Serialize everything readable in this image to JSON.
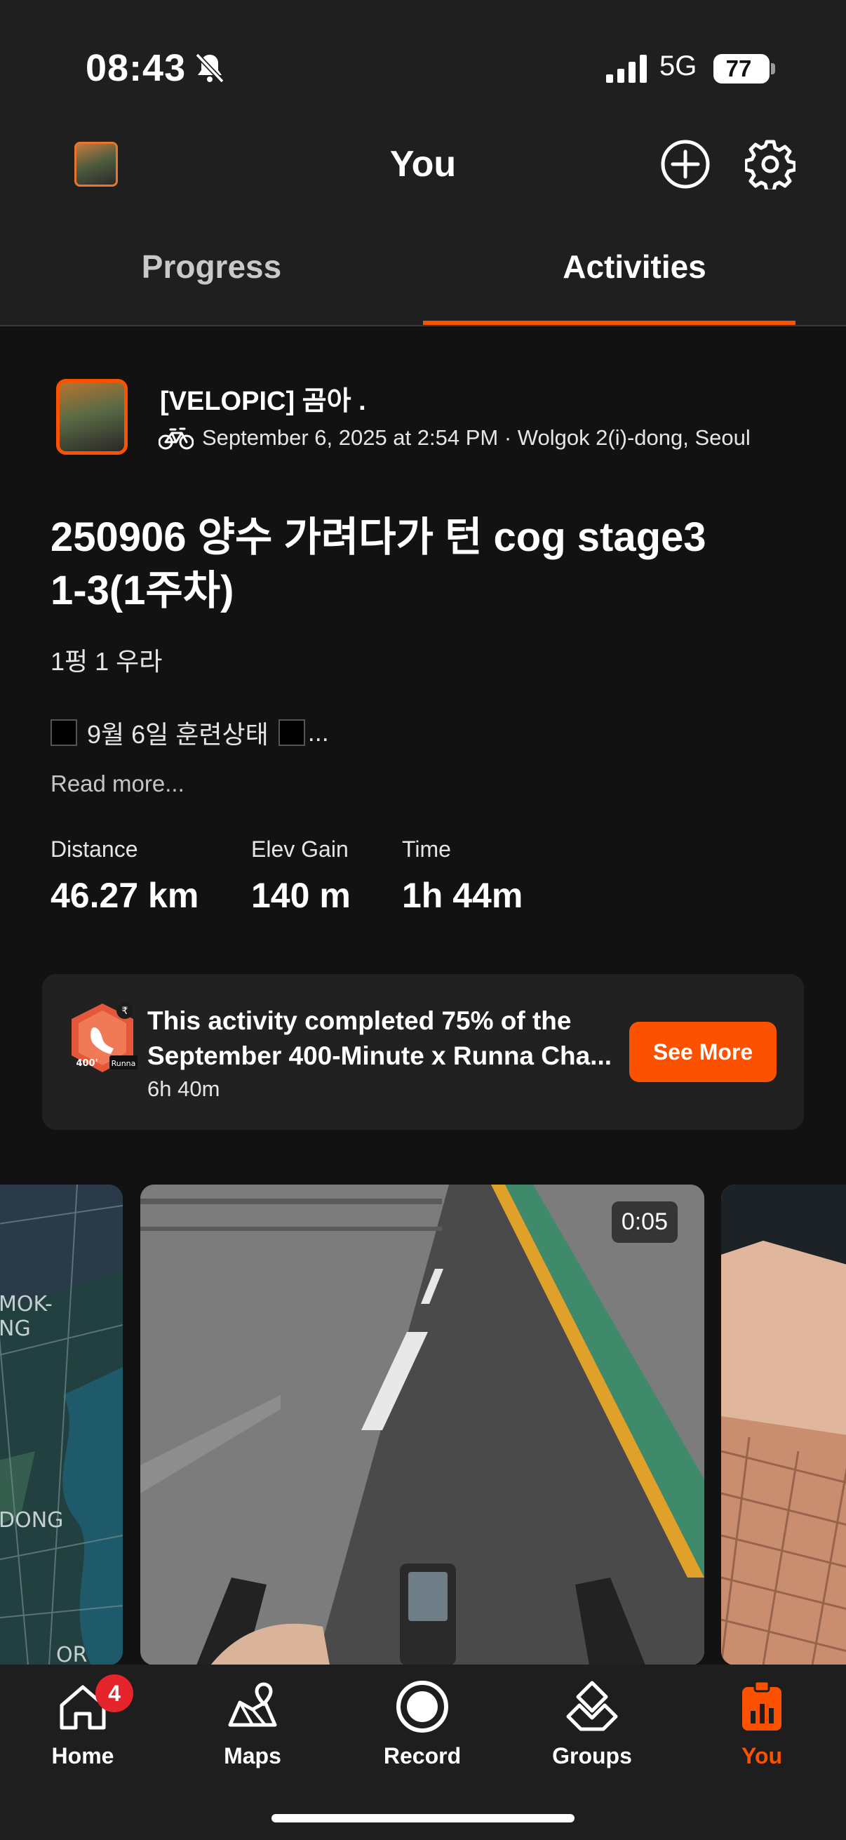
{
  "status_bar": {
    "time": "08:43",
    "network": "5G",
    "battery": "77"
  },
  "header": {
    "title": "You"
  },
  "tabs": [
    {
      "label": "Progress",
      "selected": false
    },
    {
      "label": "Activities",
      "selected": true
    }
  ],
  "activity": {
    "athlete_name": "[VELOPIC] 곰아 .",
    "meta": "September 6, 2025 at 2:54 PM · Wolgok 2(i)-dong, Seoul",
    "title": "250906 양수 가려다가 턴 cog stage3 1-3(1주차)",
    "description_line1": "1펑 1 우라",
    "description_line2": "9월 6일 훈련상태",
    "description_ellipsis": "...",
    "read_more": "Read more...",
    "stats": [
      {
        "label": "Distance",
        "value": "46.27 km"
      },
      {
        "label": "Elev Gain",
        "value": "140 m"
      },
      {
        "label": "Time",
        "value": "1h 44m"
      }
    ]
  },
  "challenge": {
    "line1": "This activity completed 75% of the",
    "line2": "September 400-Minute x Runna Cha...",
    "subtext": "6h 40m",
    "button": "See More",
    "badge_text": "400'",
    "badge_brand": "Runna"
  },
  "media": {
    "map_labels": [
      "MOK-",
      "NG",
      "DONG",
      "OR"
    ],
    "video_duration": "0:05"
  },
  "bottom_nav": [
    {
      "label": "Home",
      "icon": "home-icon",
      "badge": "4"
    },
    {
      "label": "Maps",
      "icon": "maps-icon"
    },
    {
      "label": "Record",
      "icon": "record-icon"
    },
    {
      "label": "Groups",
      "icon": "groups-icon"
    },
    {
      "label": "You",
      "icon": "you-icon",
      "active": true
    }
  ],
  "colors": {
    "accent": "#fc5200",
    "background": "#121212",
    "header_bg": "#1f1f1f",
    "card_bg": "#212121",
    "badge_red": "#e5242b"
  }
}
